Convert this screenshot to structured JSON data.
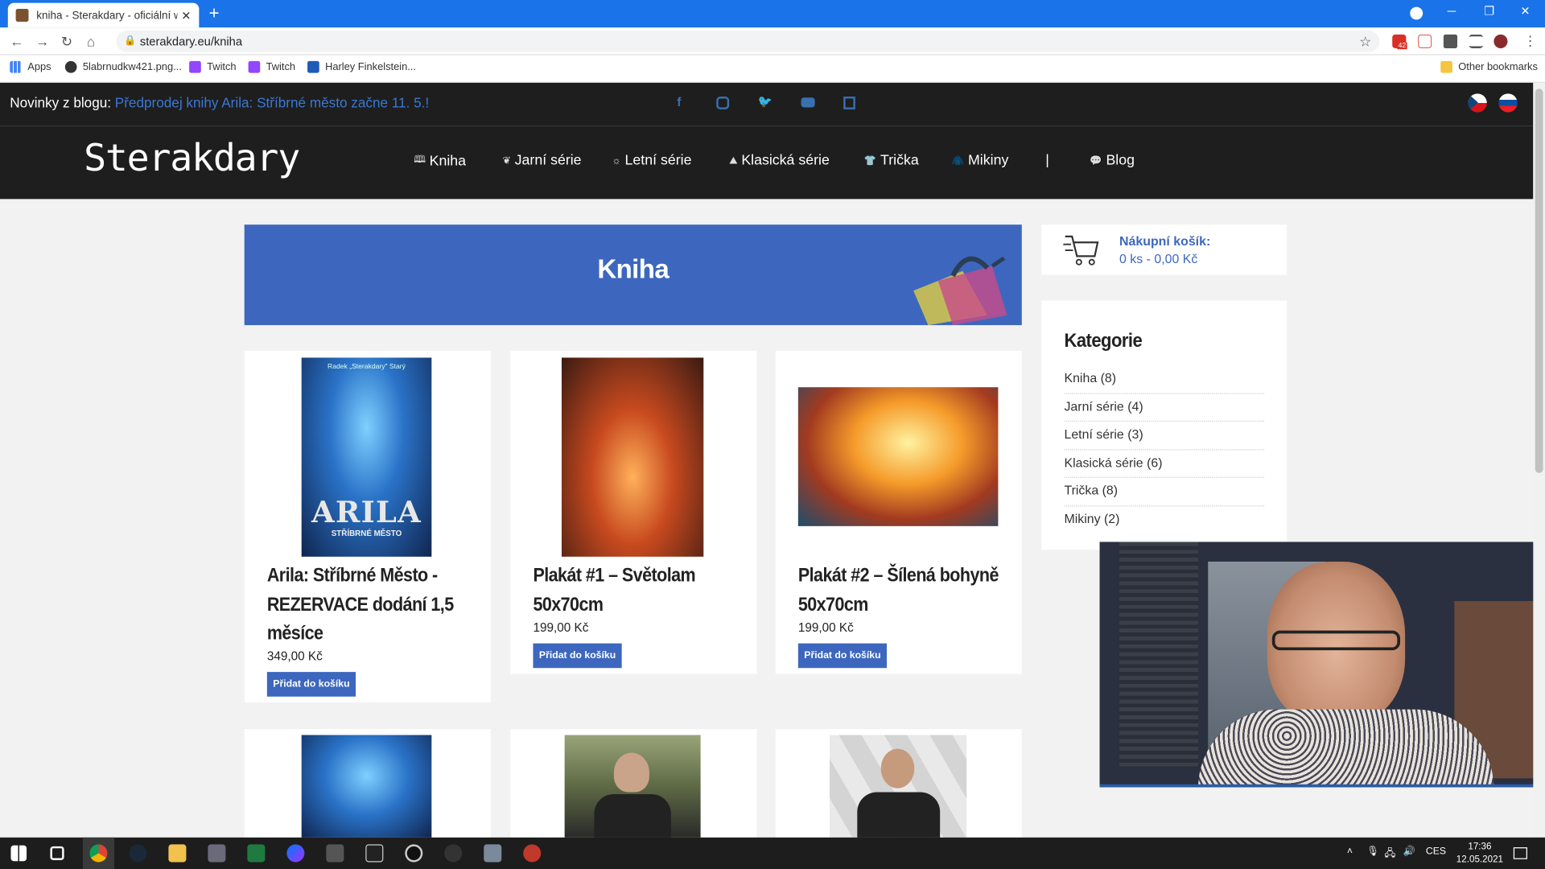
{
  "browser": {
    "tab_title": "kniha - Sterakdary - oficiální web",
    "url": "sterakdary.eu/kniha",
    "gmail_badge": "42",
    "bookmarks": [
      "Apps",
      "5labrnudkw421.png...",
      "Twitch",
      "Twitch",
      "Harley Finkelstein..."
    ],
    "other_bookmarks": "Other bookmarks"
  },
  "site": {
    "news_label": "Novinky z blogu:",
    "news_link": "Předprodej knihy Arila: Stříbrné město začne 11. 5.!",
    "logo": "Sterakdary",
    "menu": [
      {
        "icon": "book-icon",
        "glyph": "🕮",
        "label": "Kniha"
      },
      {
        "icon": "leaf-icon",
        "glyph": "❦",
        "label": "Jarní série"
      },
      {
        "icon": "sun-icon",
        "glyph": "☼",
        "label": "Letní série"
      },
      {
        "icon": "mountain-icon",
        "glyph": "⛰",
        "label": "Klasická série"
      },
      {
        "icon": "tshirt-icon",
        "glyph": "👕",
        "label": "Trička"
      },
      {
        "icon": "hoodie-icon",
        "glyph": "🧥",
        "label": "Mikiny"
      },
      {
        "icon": "separator",
        "glyph": "",
        "label": "|"
      },
      {
        "icon": "chat-icon",
        "glyph": "💬",
        "label": "Blog"
      }
    ],
    "page_title": "Kniha",
    "products": [
      {
        "title": "Arila: Stříbrné Město - REZERVACE dodání 1,5 měsíce",
        "price": "349,00 Kč",
        "button": "Přidat do košíku",
        "cover_author": "Radek „Sterakdary\" Starý",
        "cover_title": "ARILA",
        "cover_subtitle": "STŘÍBRNÉ MĚSTO"
      },
      {
        "title": "Plakát #1 – Světolam 50x70cm",
        "price": "199,00 Kč",
        "button": "Přidat do košíku"
      },
      {
        "title": "Plakát #2 – Šílená bohyně 50x70cm",
        "price": "199,00 Kč",
        "button": "Přidat do košíku"
      }
    ],
    "cart": {
      "label": "Nákupní košík:",
      "summary": "0 ks - 0,00 Kč"
    },
    "categories_title": "Kategorie",
    "categories": [
      "Kniha (8)",
      "Jarní série (4)",
      "Letní série (3)",
      "Klasická série (6)",
      "Trička (8)",
      "Mikiny (2)"
    ]
  },
  "taskbar": {
    "language": "CES",
    "time": "17:36",
    "date": "12.05.2021"
  },
  "colors": {
    "accent": "#3d67be",
    "header_bg": "#1e1e1e",
    "chrome_blue": "#1a73e8"
  }
}
